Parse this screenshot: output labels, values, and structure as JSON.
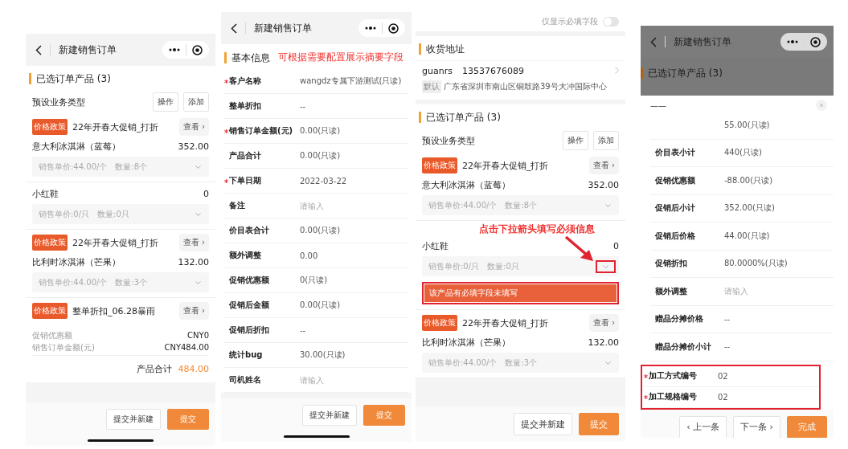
{
  "panels": [
    {
      "kind": "products",
      "nav": {
        "title": "新建销售订单"
      },
      "products_section": {
        "title": "已选订单产品 (3)",
        "business_type": "预设业务类型",
        "actions": [
          "操作",
          "添加"
        ],
        "items": [
          {
            "policy": {
              "tag": "价格政策",
              "name": "22年开春大促销_打折",
              "view": "查看 ›"
            },
            "name": "意大利冰淇淋（蓝莓）",
            "amount": "352.00",
            "price": "销售单价:44.00/个",
            "quantity": "数量:8个"
          },
          {
            "name": "小红鞋",
            "amount": "0",
            "price": "销售单价:0/只",
            "quantity": "数量:0只"
          },
          {
            "policy": {
              "tag": "价格政策",
              "name": "22年开春大促销_打折",
              "view": "查看 ›"
            },
            "name": "比利时冰淇淋（芒果）",
            "amount": "132.00",
            "price": "销售单价:44.00/个",
            "quantity": "数量:3个"
          }
        ],
        "order_policy": {
          "tag": "价格政策",
          "name": "整单折扣_06.28暴雨",
          "view": "查看 ›"
        },
        "summary": [
          {
            "label": "促销优惠额",
            "value": "CNY0"
          },
          {
            "label": "销售订单金额(元)",
            "value": "CNY484.00"
          }
        ],
        "total": {
          "label": "产品合计",
          "value": "484.00"
        }
      },
      "footer": [
        {
          "label": "提交并新建",
          "kind": "default"
        },
        {
          "label": "提交",
          "kind": "primary"
        }
      ]
    },
    {
      "kind": "form",
      "nav": {
        "title": "新建销售订单"
      },
      "section": {
        "title": "基本信息",
        "annotation": "可根据需要配置展示摘要字段"
      },
      "fields": [
        {
          "label": "客户名称",
          "required": true,
          "value": "wangdz专属下游测试(只读)"
        },
        {
          "label": "整单折扣",
          "required": false,
          "value": "--"
        },
        {
          "label": "销售订单金额(元)",
          "required": true,
          "value": "0.00(只读)"
        },
        {
          "label": "产品合计",
          "required": false,
          "value": "0.00(只读)"
        },
        {
          "label": "下单日期",
          "required": true,
          "value": "2022-03-22"
        },
        {
          "label": "备注",
          "required": false,
          "placeholder": "请输入"
        },
        {
          "label": "价目表合计",
          "required": false,
          "value": "0.00(只读)"
        },
        {
          "label": "额外调整",
          "required": false,
          "value": "0.00"
        },
        {
          "label": "促销优惠额",
          "required": false,
          "value": "0(只读)"
        },
        {
          "label": "促销后金额",
          "required": false,
          "value": "0.00(只读)"
        },
        {
          "label": "促销后折扣",
          "required": false,
          "value": "--"
        },
        {
          "label": "统计bug",
          "required": false,
          "value": "30.00(只读)"
        },
        {
          "label": "司机姓名",
          "required": false,
          "placeholder": "请输入"
        }
      ],
      "footer": [
        {
          "label": "提交并新建",
          "kind": "default"
        },
        {
          "label": "提交",
          "kind": "primary"
        }
      ]
    },
    {
      "kind": "address_products",
      "required_only": {
        "label": "仅显示必填字段",
        "on": false
      },
      "address_section": {
        "title": "收货地址",
        "name": "guanrs",
        "phone": "13537676089",
        "tag": "默认",
        "address": "广东省深圳市南山区铜鼓路39号大冲国际中心"
      },
      "products_section": {
        "title": "已选订单产品 (3)",
        "business_type": "预设业务类型",
        "actions": [
          "操作",
          "添加"
        ],
        "items": [
          {
            "policy": {
              "tag": "价格政策",
              "name": "22年开春大促销_打折",
              "view": "查看 ›"
            },
            "name": "意大利冰淇淋（蓝莓）",
            "amount": "352.00",
            "price": "销售单价:44.00/个",
            "quantity": "数量:8个"
          },
          {
            "name": "小红鞋",
            "amount": "0",
            "price": "销售单价:0/只",
            "quantity": "数量:0只",
            "annotation": "点击下拉箭头填写必须信息",
            "error": "该产品有必填字段未填写"
          },
          {
            "policy": {
              "tag": "价格政策",
              "name": "22年开春大促销_打折",
              "view": "查看 ›"
            },
            "name": "比利时冰淇淋（芒果）",
            "amount": "132.00",
            "price": "销售单价:44.00/个",
            "quantity": "数量:3个"
          }
        ]
      },
      "footer": [
        {
          "label": "提交并新建",
          "kind": "default"
        },
        {
          "label": "提交",
          "kind": "primary"
        }
      ]
    },
    {
      "kind": "detail_sheet",
      "nav": {
        "title": "新建销售订单"
      },
      "background_section": "已选订单产品 (3)",
      "sheet": {
        "title": "——",
        "fields": [
          {
            "value": "55.00(只读)"
          },
          {
            "label": "价目表小计",
            "value": "440(只读)"
          },
          {
            "label": "促销优惠额",
            "value": "-88.00(只读)"
          },
          {
            "label": "促销后小计",
            "value": "352.00(只读)"
          },
          {
            "label": "促销后价格",
            "value": "44.00(只读)"
          },
          {
            "label": "促销折扣",
            "value": "80.0000%(只读)"
          },
          {
            "label": "额外调整",
            "placeholder": "请输入"
          },
          {
            "label": "赠品分摊价格",
            "value": "--"
          },
          {
            "label": "赠品分摊价小计",
            "value": "--"
          }
        ],
        "highlighted_fields": [
          {
            "label": "加工方式编号",
            "required": true,
            "value": "02"
          },
          {
            "label": "加工规格编号",
            "required": true,
            "value": "02"
          }
        ]
      },
      "footer": [
        {
          "label": "‹ 上一条",
          "kind": "default"
        },
        {
          "label": "下一条 ›",
          "kind": "default"
        },
        {
          "label": "完成",
          "kind": "primary"
        }
      ]
    }
  ]
}
